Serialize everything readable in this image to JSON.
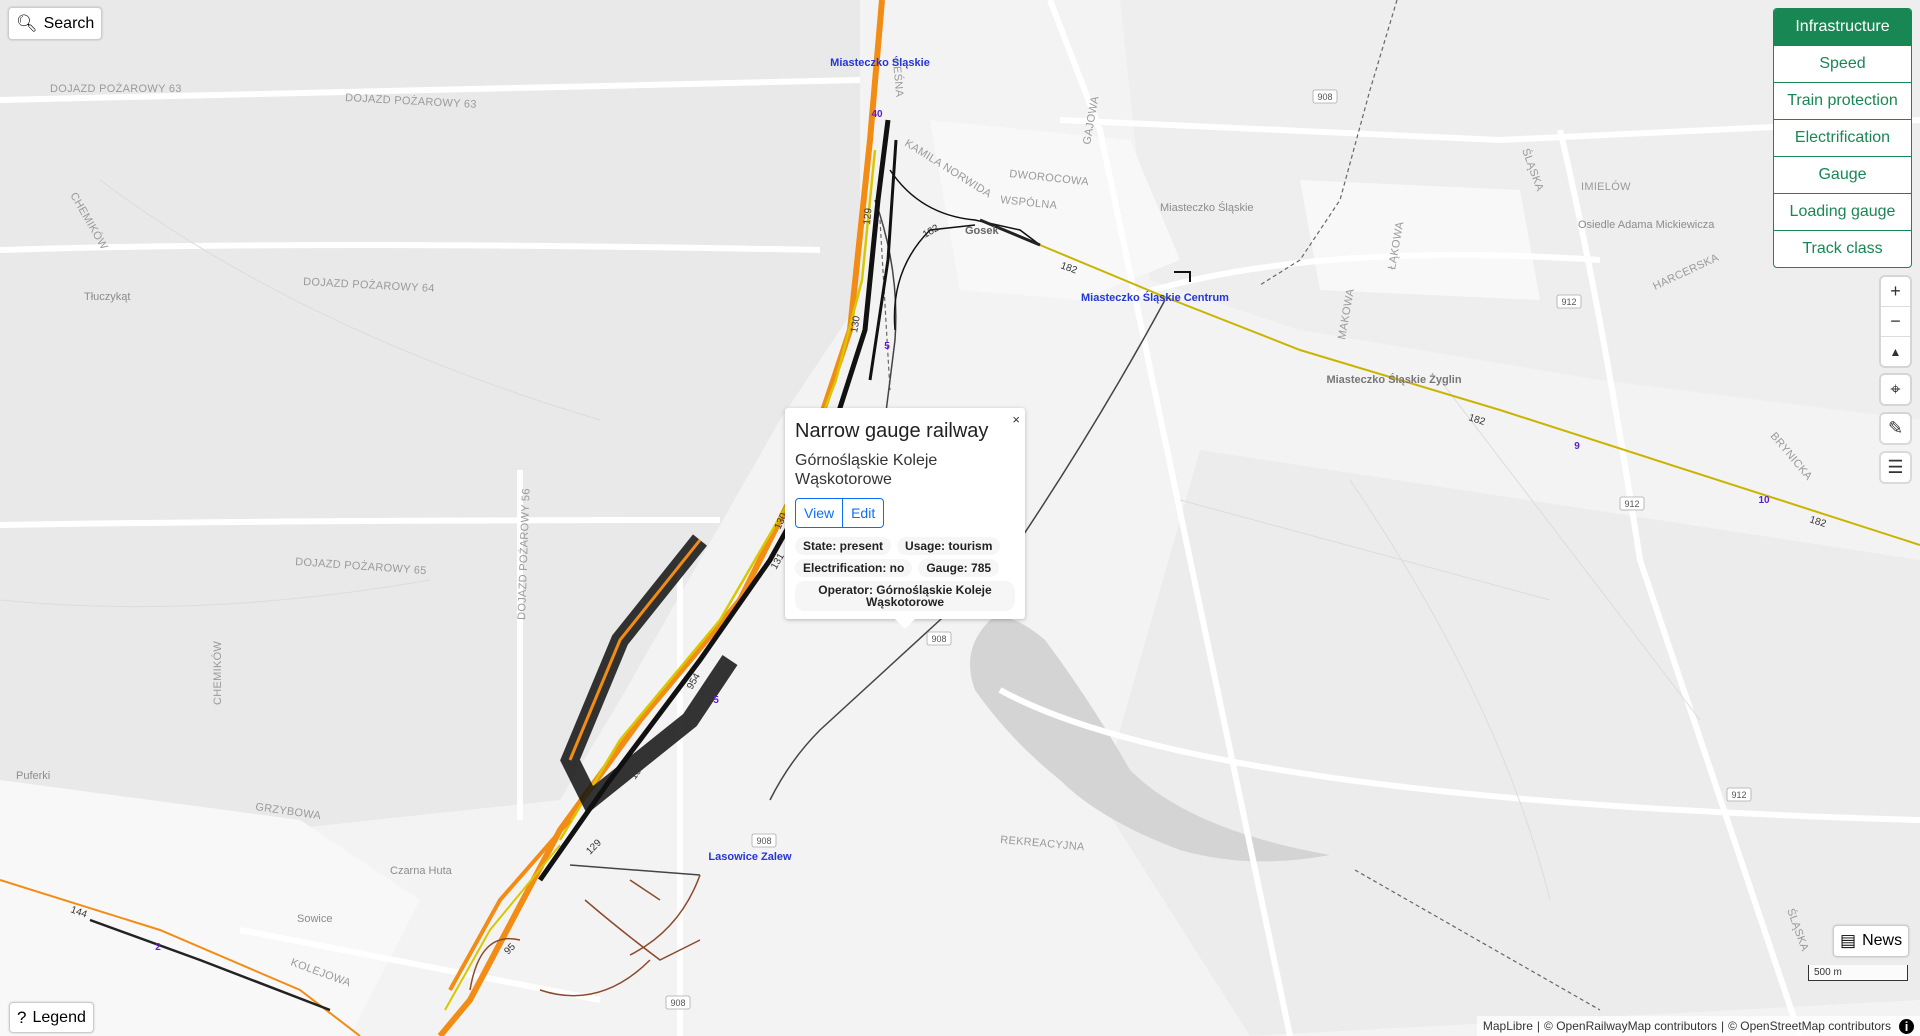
{
  "search": {
    "label": "Search"
  },
  "legend": {
    "label": "Legend"
  },
  "news": {
    "label": "News"
  },
  "styles": [
    {
      "label": "Infrastructure",
      "active": true
    },
    {
      "label": "Speed"
    },
    {
      "label": "Train protection"
    },
    {
      "label": "Electrification"
    },
    {
      "label": "Gauge"
    },
    {
      "label": "Loading gauge"
    },
    {
      "label": "Track class"
    }
  ],
  "controls": {
    "zoom_in": "+",
    "zoom_out": "−",
    "compass": "◆"
  },
  "scale": {
    "label": "500 m"
  },
  "attribution": {
    "maplibre": "MapLibre",
    "orm": "© OpenRailwayMap contributors",
    "osm": "© OpenStreetMap contributors",
    "info": "i",
    "separator": "|"
  },
  "popup": {
    "close": "×",
    "title": "Narrow gauge railway",
    "subtitle": "Górnośląskie Koleje Wąskotorowe",
    "view": "View",
    "edit": "Edit",
    "state": "State: present",
    "usage": "Usage: tourism",
    "electrification": "Electrification: no",
    "gauge": "Gauge: 785",
    "operator": "Operator: Górnośląskie Koleje Wąskotorowe"
  },
  "map": {
    "road_labels": [
      "DOJAZD POŻAROWY 63",
      "DOJAZD POŻAROWY 63",
      "DOJAZD POŻAROWY 64",
      "DOJAZD POŻAROWY 65",
      "DOJAZD POŻAROWY 56",
      "CHEMIKÓW",
      "CHEMIKÓW",
      "GRZYBOWA",
      "KOLEJOWA",
      "REKREACYJNA",
      "DWOROCOWA",
      "WSPÓLNA",
      "GAJOWA",
      "LEŚNA",
      "ŁĄKOWA",
      "MAKOWA",
      "IMIELÓW",
      "HARCERSKA",
      "BRYNICKA",
      "ŚLĄSKA",
      "ŚLĄSKA",
      "KAMILA NORWIDA"
    ],
    "place_labels": [
      "Miasteczko Śląskie",
      "Tłuczykąt",
      "Puferki",
      "Czarna Huta",
      "Sowice",
      "Osiedle Adama Mickiewicza",
      "Gosek"
    ],
    "stations": [
      {
        "name": "Miasteczko Śląskie"
      },
      {
        "name": "Miasteczko Śląskie Centrum"
      },
      {
        "name": "Lasowice Zalew"
      },
      {
        "name": "Miasteczko Śląskie Żyglin"
      }
    ],
    "road_refs": [
      "908",
      "912",
      "912",
      "912",
      "908",
      "908",
      "908"
    ],
    "line_refs": [
      "129",
      "130",
      "130",
      "131",
      "131",
      "129",
      "182",
      "182",
      "182",
      "182",
      "144",
      "95",
      "954",
      "912"
    ],
    "km_markers": [
      "40",
      "5",
      "9",
      "10",
      "2",
      "5"
    ]
  }
}
